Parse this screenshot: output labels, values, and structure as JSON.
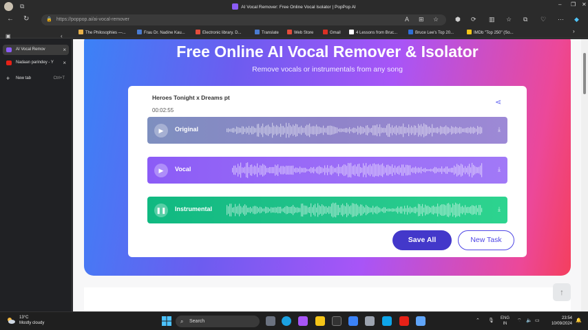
{
  "window": {
    "title": "AI Vocal Remover: Free Online Vocal Isolator | PopPop AI",
    "controls": [
      "–",
      "❐",
      "✕"
    ]
  },
  "addressbar": {
    "url": "https://poppop.ai/ai-vocal-remover"
  },
  "bookmarks": [
    {
      "label": "The Philosophies —...",
      "color": "#e8b14a"
    },
    {
      "label": "Frau Dr. Nadine Kau...",
      "color": "#4a7bd0"
    },
    {
      "label": "Electronic library. D...",
      "color": "#e34c3b"
    },
    {
      "label": "Translate",
      "color": "#4a7bd0"
    },
    {
      "label": "Web Store",
      "color": "#e34c3b"
    },
    {
      "label": "Gmail",
      "color": "#d93025"
    },
    {
      "label": "4 Lessons from Bruc...",
      "color": "#ffffff"
    },
    {
      "label": "Bruce Lee's Top 20...",
      "color": "#2f6fd6"
    },
    {
      "label": "IMDb \"Top 250\" (So...",
      "color": "#f5c518"
    }
  ],
  "sidebar": {
    "tabs": [
      {
        "label": "AI Vocal Remov",
        "color": "#8b5cf6",
        "active": true
      },
      {
        "label": "Nadaan parindey - Y",
        "color": "#e62117",
        "active": false
      }
    ],
    "new_tab": {
      "label": "New tab",
      "shortcut": "Ctrl+T"
    }
  },
  "hero": {
    "title": "Free Online AI Vocal Remover & Isolator",
    "subtitle": "Remove vocals or instrumentals from any song"
  },
  "player": {
    "song_title": "Heroes Tonight x Dreams pt",
    "duration": "00:02:55",
    "tracks": [
      {
        "label": "Original",
        "state": "play",
        "colors": [
          "#7e8fbf",
          "#8f84c9",
          "#9d89d6"
        ]
      },
      {
        "label": "Vocal",
        "state": "play",
        "colors": [
          "#8b5cf6",
          "#9b6cf7",
          "#a179f7"
        ]
      },
      {
        "label": "Instrumental",
        "state": "pause",
        "colors": [
          "#10b981",
          "#22c38a",
          "#2dd48f"
        ]
      }
    ],
    "save_all": "Save All",
    "new_task": "New Task"
  },
  "taskbar": {
    "weather_temp": "13°C",
    "weather_desc": "Mostly cloudy",
    "search_placeholder": "Search",
    "lang": "ENG",
    "region": "IN",
    "time": "23:54",
    "date": "10/09/2024"
  }
}
